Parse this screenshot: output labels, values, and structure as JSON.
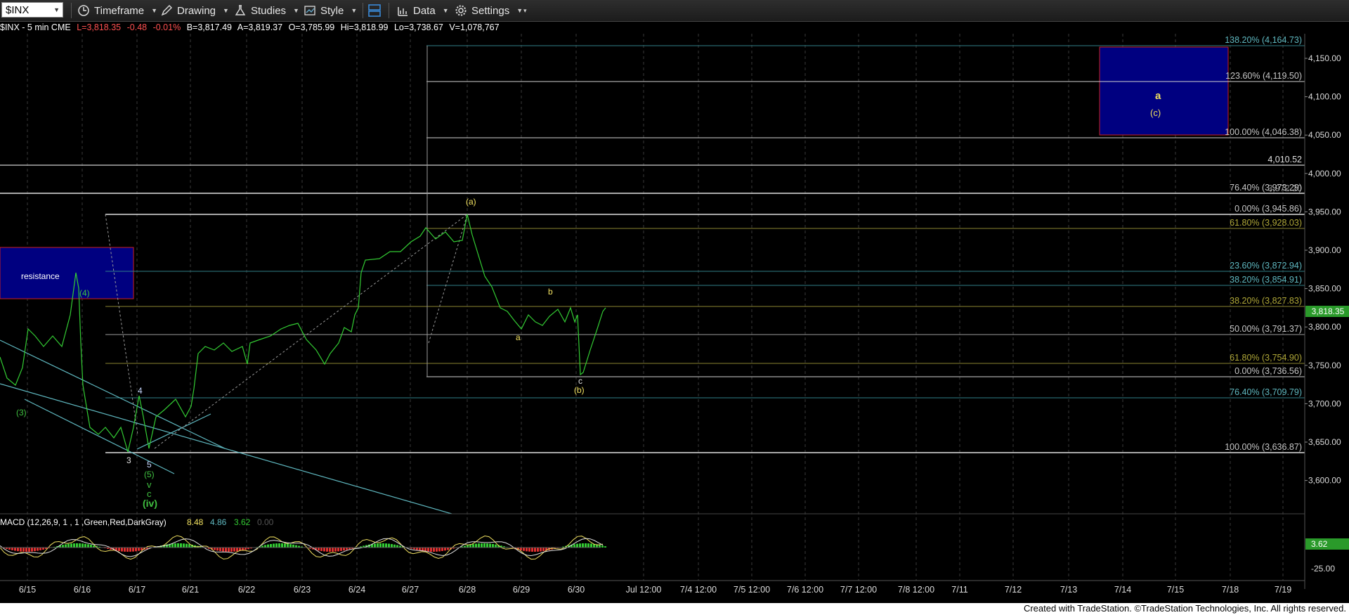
{
  "toolbar": {
    "symbol": "$INX",
    "timeframe": "Timeframe",
    "drawing": "Drawing",
    "studies": "Studies",
    "style": "Style",
    "data": "Data",
    "settings": "Settings"
  },
  "info": {
    "name": "$INX - 5 min  CME",
    "last": "L=3,818.35",
    "chg": "-0.48",
    "pct": "-0.01%",
    "bid": "B=3,817.49",
    "ask": "A=3,819.37",
    "open": "O=3,785.99",
    "high": "Hi=3,818.99",
    "low": "Lo=3,738.67",
    "volume": "V=1,078,767"
  },
  "colors": {
    "up": "#33cc33",
    "down": "#e03030",
    "fib_teal": "#5fb8c0",
    "fib_olive": "#b0a838",
    "fib_gray": "#c8c8c8",
    "target_box": "#000080",
    "resistance_border": "#cc2020",
    "wave_yellow": "#f0e060",
    "wave_green": "#40c040"
  },
  "price_axis": {
    "ticks": [
      "4,150.00",
      "4,100.00",
      "4,050.00",
      "4,000.00",
      "3,950.00",
      "3,900.00",
      "3,850.00",
      "3,800.00",
      "3,750.00",
      "3,700.00",
      "3,650.00",
      "3,600.00"
    ],
    "last_price": "3,818.35"
  },
  "macd": {
    "label": "MACD (12,26,9, 1 , 1 ,Green,Red,DarkGray)",
    "v1": "8.48",
    "v2": "4.86",
    "v3": "3.62",
    "v4": "0.00",
    "axis_value": "3.62",
    "axis_low": "-25.00"
  },
  "time_axis": [
    "6/15",
    "6/16",
    "6/17",
    "6/21",
    "6/22",
    "6/23",
    "6/24",
    "6/27",
    "6/28",
    "6/29",
    "6/30",
    "Jul 12:00",
    "7/4 12:00",
    "7/5 12:00",
    "7/6 12:00",
    "7/7 12:00",
    "7/8 12:00",
    "7/11",
    "7/12",
    "7/13",
    "7/14",
    "7/15",
    "7/18",
    "7/19"
  ],
  "fib_labels": {
    "f1382": "138.20% (4,164.73)",
    "f1236": "123.60% (4,119.50)",
    "f1000": "100.00% (4,046.38)",
    "l4010": "4,010.52",
    "f764": "76.40% (3,973.29)",
    "f764_over": "3,972.20",
    "f0_top": "0.00% (3,945.86)",
    "f618_top": "61.80% (3,928.03)",
    "f236": "23.60% (3,872.94)",
    "f382_a": "38.20% (3,854.91)",
    "f382_b": "38.20% (3,827.83)",
    "f50": "50.00% (3,791.37)",
    "f618_b": "61.80% (3,754.90)",
    "f0_b": "0.00% (3,736.56)",
    "f764_b": "76.40% (3,709.79)",
    "f100_b": "100.00% (3,636.87)"
  },
  "annotations": {
    "resistance": "resistance",
    "box_a": "a",
    "box_c": "(c)",
    "w_a_paren": "(a)",
    "w_b_paren": "(b)",
    "w_a": "a",
    "w_b": "b",
    "w_c": "c",
    "w_4p": "(4)",
    "w_3p": "(3)",
    "w_5p": "(5)",
    "w_4": "4",
    "w_3": "3",
    "w_5": "5",
    "w_v": "v",
    "w_c2": "c",
    "w_iv": "(iv)"
  },
  "footer": "Created with TradeStation. ©TradeStation Technologies, Inc. All rights reserved."
}
